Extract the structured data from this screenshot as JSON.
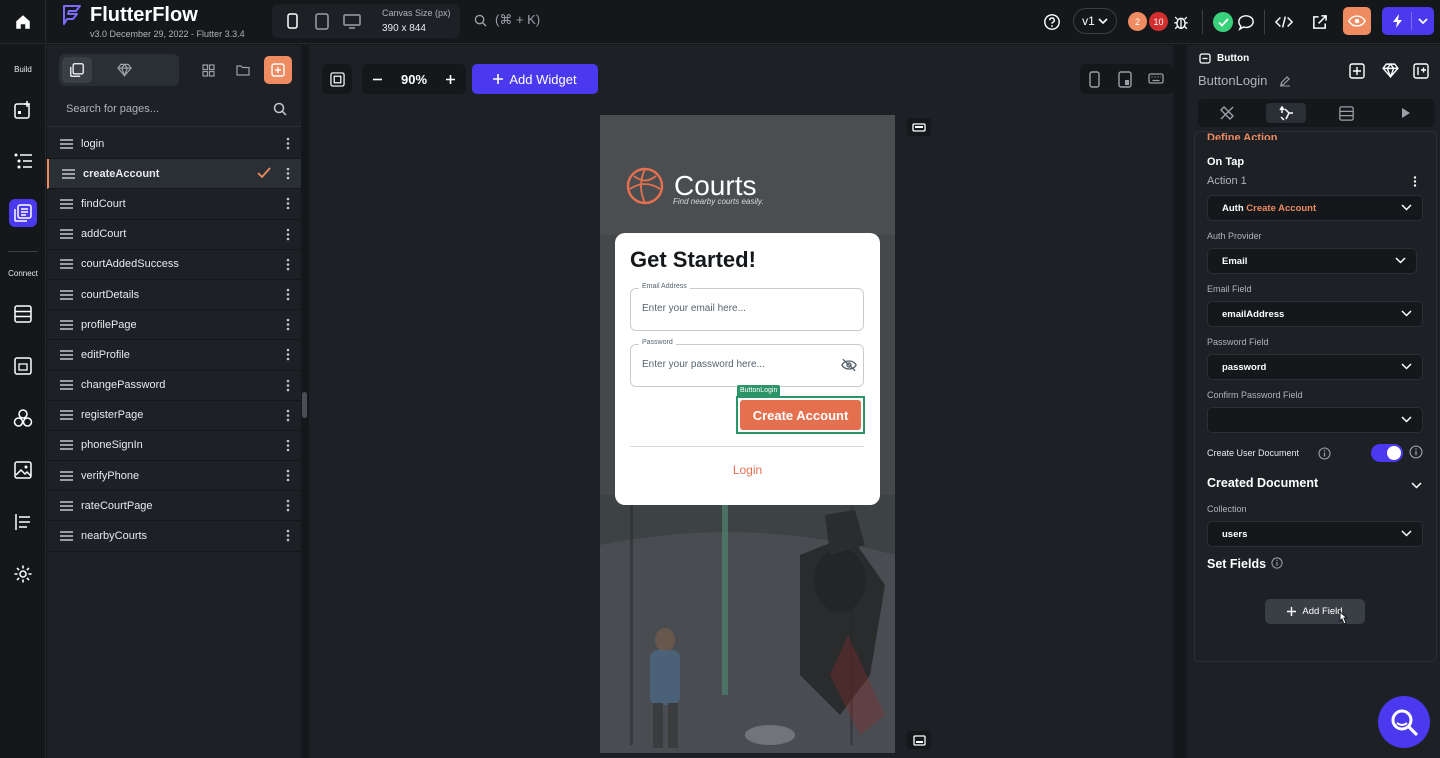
{
  "app": {
    "name": "FlutterFlow",
    "version": "v3.0 December 29, 2022 - Flutter 3.3.4",
    "canvas_size_label": "Canvas Size (px)",
    "canvas_size_value": "390 x 844",
    "search_shortcut": "(⌘ + K)",
    "version_selector": "v1",
    "warnings_count": "2",
    "errors_count": "10"
  },
  "rail": {
    "build_label": "Build",
    "connect_label": "Connect"
  },
  "pages": {
    "search_placeholder": "Search for pages...",
    "items": [
      {
        "label": "login"
      },
      {
        "label": "createAccount"
      },
      {
        "label": "findCourt"
      },
      {
        "label": "addCourt"
      },
      {
        "label": "courtAddedSuccess"
      },
      {
        "label": "courtDetails"
      },
      {
        "label": "profilePage"
      },
      {
        "label": "editProfile"
      },
      {
        "label": "changePassword"
      },
      {
        "label": "registerPage"
      },
      {
        "label": "phoneSignIn"
      },
      {
        "label": "verifyPhone"
      },
      {
        "label": "rateCourtPage"
      },
      {
        "label": "nearbyCourts"
      }
    ],
    "active_index": 1
  },
  "canvas": {
    "zoom": "90%",
    "add_widget_label": "Add Widget",
    "phone": {
      "brand": "Courts",
      "tagline": "Find nearby courts easily.",
      "heading": "Get Started!",
      "email_label": "Email Address",
      "email_placeholder": "Enter your email here...",
      "password_label": "Password",
      "password_placeholder": "Enter your password here...",
      "button_tag": "ButtonLogin",
      "button_label": "Create Account",
      "login_link": "Login"
    }
  },
  "properties": {
    "widget_type": "Button",
    "widget_name": "ButtonLogin",
    "section_title": "Define Action",
    "trigger": "On Tap",
    "action_name": "Action 1",
    "action_prefix": "Auth",
    "action_value": "Create Account",
    "auth_provider_label": "Auth Provider",
    "auth_provider_value": "Email",
    "email_field_label": "Email Field",
    "email_field_value": "emailAddress",
    "password_field_label": "Password Field",
    "password_field_value": "password",
    "confirm_password_label": "Confirm Password Field",
    "confirm_password_value": "",
    "create_user_doc_label": "Create User Document",
    "create_user_doc_on": true,
    "created_document_label": "Created Document",
    "collection_label": "Collection",
    "collection_value": "users",
    "set_fields_label": "Set Fields",
    "add_field_label": "Add Field"
  },
  "colors": {
    "accent": "#4b39ef",
    "brand_orange": "#ee8b60",
    "button_orange": "#e4704f",
    "selection_green": "#2d9467",
    "background": "#14181b",
    "panel": "#1d2126"
  }
}
